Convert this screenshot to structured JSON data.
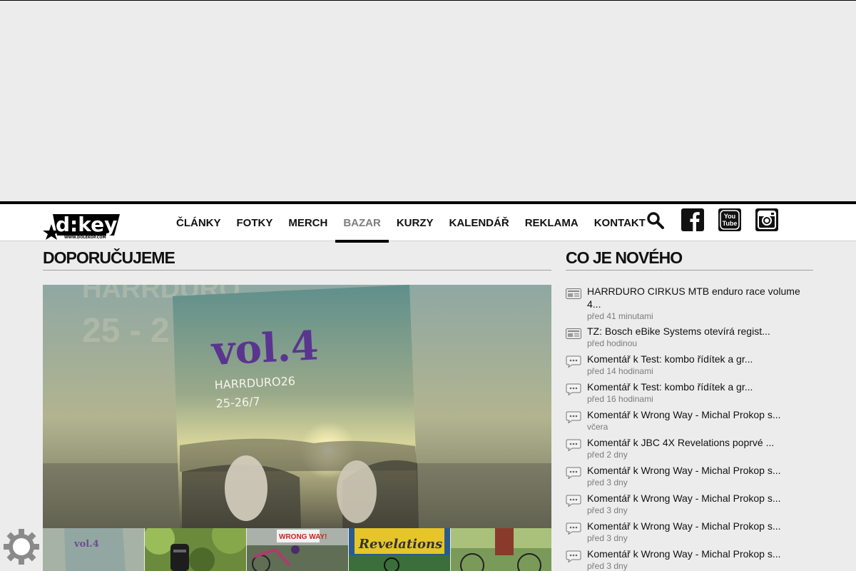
{
  "nav": {
    "logo_text": "d:key",
    "logo_url_text": "WWW.DOLEKOP.COM",
    "items": [
      {
        "label": "ČLÁNKY",
        "active": false
      },
      {
        "label": "FOTKY",
        "active": false
      },
      {
        "label": "MERCH",
        "active": false
      },
      {
        "label": "BAZAR",
        "active": true
      },
      {
        "label": "KURZY",
        "active": false
      },
      {
        "label": "KALENDÁŘ",
        "active": false
      },
      {
        "label": "REKLAMA",
        "active": false
      },
      {
        "label": "KONTAKT",
        "active": false
      }
    ],
    "icons": [
      "search-icon",
      "facebook-icon",
      "youtube-icon",
      "instagram-icon"
    ],
    "youtube_text_1": "You",
    "youtube_text_2": "Tube"
  },
  "recommend": {
    "title": "DOPORUČUJEME",
    "hero": {
      "poster_title": "vol.4",
      "poster_event": "HARRDURO26",
      "poster_dates": "25-26/7",
      "bg_text_1": "HARRDURO",
      "bg_text_2": "25 - 2"
    },
    "thumbs": [
      {
        "kind": "poster",
        "caption": "vol.4"
      },
      {
        "kind": "forest",
        "caption": ""
      },
      {
        "kind": "sign",
        "caption": "WRONG WAY!"
      },
      {
        "kind": "graffiti",
        "caption": "Revelations"
      },
      {
        "kind": "trail",
        "caption": ""
      }
    ]
  },
  "news": {
    "title": "CO JE NOVÉHO",
    "items": [
      {
        "icon": "article-icon",
        "title": "HARRDURO CIRKUS MTB enduro race volume 4...",
        "time": "před 41 minutami"
      },
      {
        "icon": "article-icon",
        "title": "TZ: Bosch eBike Systems otevírá regist...",
        "time": "před hodinou"
      },
      {
        "icon": "comment-icon",
        "title": "Komentář k Test: kombo řídítek a gr...",
        "time": "před 14 hodinami"
      },
      {
        "icon": "comment-icon",
        "title": "Komentář k Test: kombo řídítek a gr...",
        "time": "před 16 hodinami"
      },
      {
        "icon": "comment-icon",
        "title": "Komentář k Wrong Way - Michal Prokop s...",
        "time": "včera"
      },
      {
        "icon": "comment-icon",
        "title": "Komentář k JBC 4X Revelations poprvé ...",
        "time": "před 2 dny"
      },
      {
        "icon": "comment-icon",
        "title": "Komentář k Wrong Way - Michal Prokop s...",
        "time": "před 3 dny"
      },
      {
        "icon": "comment-icon",
        "title": "Komentář k Wrong Way - Michal Prokop s...",
        "time": "před 3 dny"
      },
      {
        "icon": "comment-icon",
        "title": "Komentář k Wrong Way - Michal Prokop s...",
        "time": "před 3 dny"
      },
      {
        "icon": "comment-icon",
        "title": "Komentář k Wrong Way - Michal Prokop s...",
        "time": "před 3 dny"
      }
    ]
  },
  "colors": {
    "accent": "#000000",
    "active_nav": "#7d7d7d",
    "muted_text": "#7c7c7c",
    "poster_purple": "#5a3590"
  }
}
